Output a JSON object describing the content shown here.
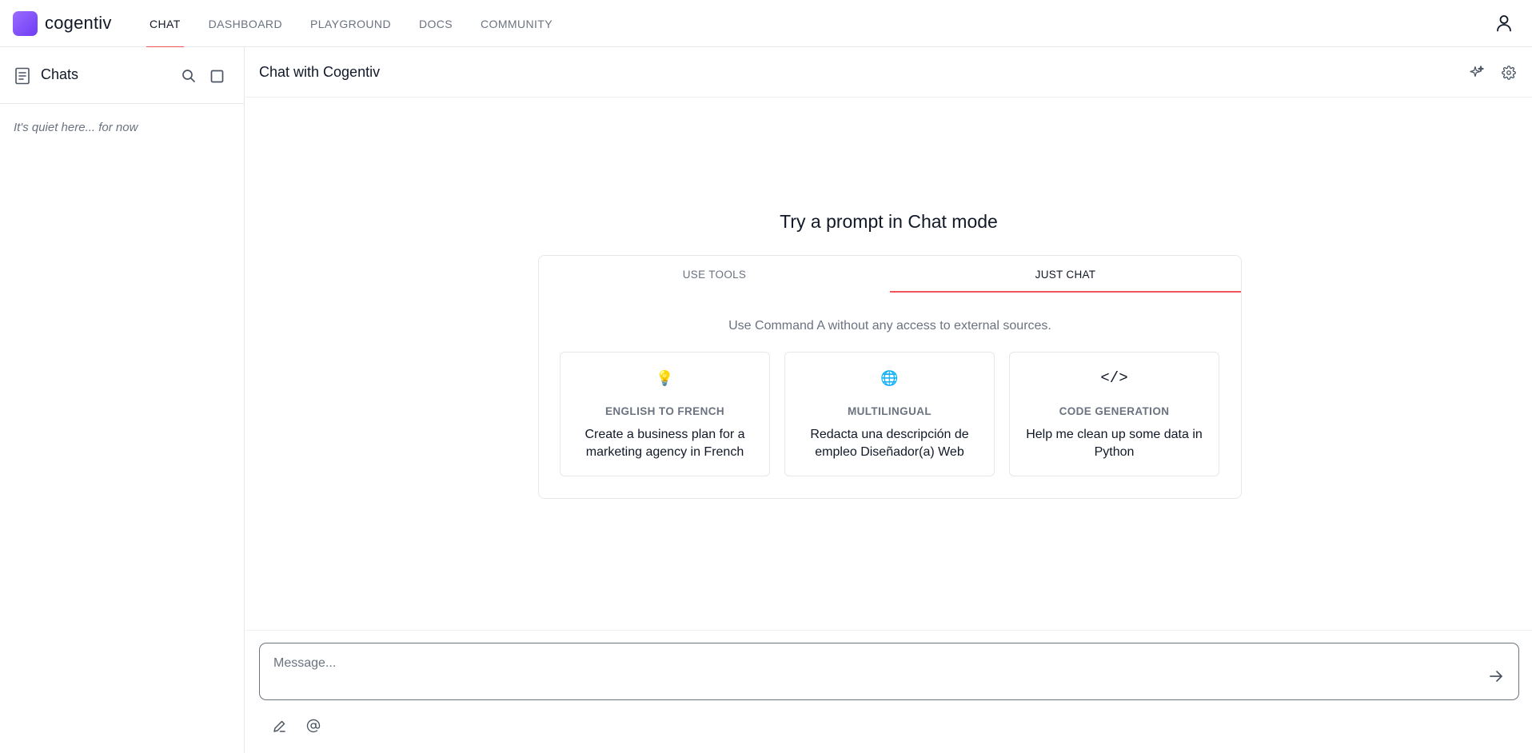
{
  "app": {
    "name": "cogentiv",
    "brand_color": "#7c4dff"
  },
  "nav": {
    "items": [
      {
        "label": "CHAT",
        "active": true
      },
      {
        "label": "DASHBOARD",
        "active": false
      },
      {
        "label": "PLAYGROUND",
        "active": false
      },
      {
        "label": "DOCS",
        "active": false
      },
      {
        "label": "COMMUNITY",
        "active": false
      }
    ],
    "accent_color": "#f2545b",
    "user_icon": "user-icon"
  },
  "sidebar": {
    "title": "Chats",
    "icons": [
      "document-icon",
      "search-icon",
      "new-chat-icon"
    ],
    "empty_text": "It's quiet here... for now"
  },
  "main": {
    "title": "Chat with Cogentiv",
    "header_icons": [
      "sparkle-icon",
      "gear-icon"
    ],
    "prompt_title": "Try a prompt in Chat mode",
    "tabs": [
      {
        "label": "USE TOOLS",
        "active": false
      },
      {
        "label": "JUST CHAT",
        "active": true
      }
    ],
    "description": "Use Command A without any access to external sources.",
    "examples": [
      {
        "icon": "💡",
        "label": "ENGLISH TO FRENCH",
        "text": "Create a business plan for a marketing agency in French"
      },
      {
        "icon": "🌐",
        "label": "MULTILINGUAL",
        "text": "Redacta una descripción de empleo Diseñador(a) Web"
      },
      {
        "icon": "</>",
        "label": "CODE GENERATION",
        "text": "Help me clean up some data in Python"
      }
    ]
  },
  "composer": {
    "placeholder": "Message...",
    "value": "",
    "icons": [
      "send-arrow-icon",
      "pen-icon",
      "at-icon"
    ]
  }
}
